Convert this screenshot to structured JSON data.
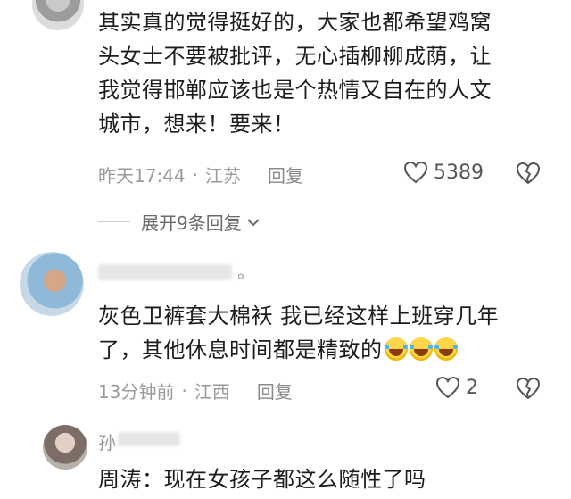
{
  "comments": [
    {
      "text_lines": [
        "其实真的觉得挺好的，大家也都希望鸡窝",
        "头女士不要被批评，无心插柳柳成荫，让",
        "我觉得邯郸应该也是个热情又自在的人文",
        "城市，想来！要来！"
      ],
      "time": "昨天17:44",
      "location": "江苏",
      "reply_label": "回复",
      "likes": "5389",
      "expand_label": "展开9条回复"
    },
    {
      "name_suffix": "。",
      "text_lines": [
        "灰色卫裤套大棉袄  我已经这样上班穿几年",
        "了，其他休息时间都是精致的"
      ],
      "emoji": [
        "rofl",
        "rofl",
        "rofl"
      ],
      "time": "13分钟前",
      "location": "江西",
      "reply_label": "回复",
      "likes": "2"
    },
    {
      "name_prefix": "孙",
      "text_lines": [
        "周涛：现在女孩子都这么随性了吗"
      ]
    }
  ],
  "icons": {
    "like": "heart-outline-icon",
    "dislike": "broken-heart-icon",
    "expand": "chevron-down-icon"
  }
}
